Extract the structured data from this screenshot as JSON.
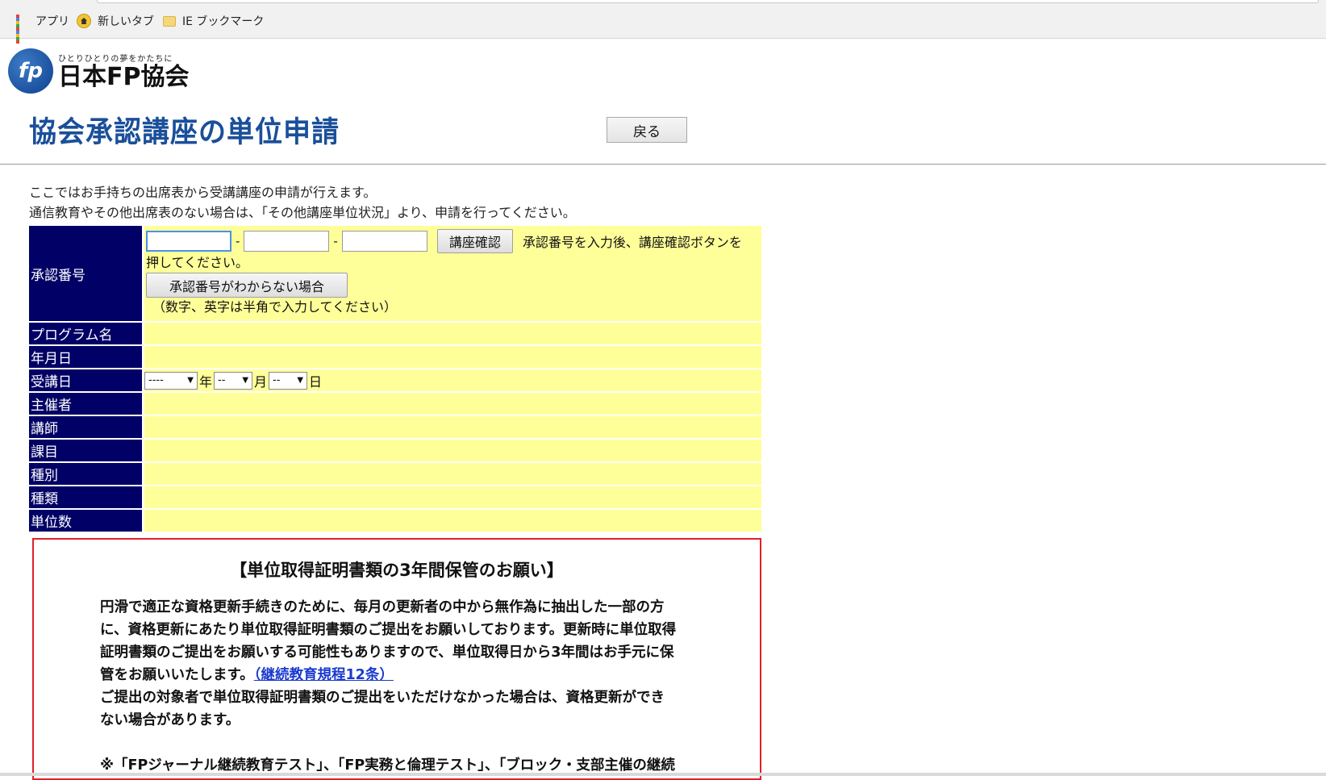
{
  "bookmarks": [
    {
      "label": "アプリ",
      "icon": "apps-grid-icon"
    },
    {
      "label": "新しいタブ",
      "icon": "home-icon"
    },
    {
      "label": "IE ブックマーク",
      "icon": "folder-icon"
    }
  ],
  "header": {
    "logo_tagline": "ひとりひとりの夢をかたちに",
    "logo_name": "日本FP協会",
    "page_title": "協会承認講座の単位申請",
    "back_label": "戻る"
  },
  "intro": [
    "ここではお手持ちの出席表から受講講座の申請が行えます。",
    "通信教育やその他出席表のない場合は、「その他講座単位状況」より、申請を行ってください。"
  ],
  "form": {
    "approval_label": "承認番号",
    "confirm_label": "講座確認",
    "hint_1": "承認番号を入力後、講座確認ボタンを",
    "hint_2": "押してください。",
    "unknown_label": "承認番号がわからない場合",
    "note": "（数字、英字は半角で入力してください）",
    "dash": "-",
    "program_label": "プログラム名",
    "date_label": "年月日",
    "attend_label": "受講日",
    "year_value": "----",
    "month_value": "--",
    "day_value": "--",
    "year_unit": "年",
    "month_unit": "月",
    "day_unit": "日",
    "host_label": "主催者",
    "lecturer_label": "講師",
    "subject_label": "課目",
    "category_label": "種別",
    "type_label": "種類",
    "credits_label": "単位数"
  },
  "notice": {
    "title": "【単位取得証明書類の3年間保管のお願い】",
    "para1_lines": [
      "円滑で適正な資格更新手続きのために、毎月の更新者の中から無作為に抽出した一部の方",
      "に、資格更新にあたり単位取得証明書類のご提出をお願いしております。更新時に単位取得",
      "証明書類のご提出をお願いする可能性もありますので、単位取得日から3年間はお手元に保"
    ],
    "para1_last": "管をお願いいたします。",
    "link": "（継続教育規程12条）",
    "para2_lines": [
      "ご提出の対象者で単位取得証明書類のご提出をいただけなかった場合は、資格更新ができ",
      "ない場合があります。"
    ],
    "para3": "※「FPジャーナル継続教育テスト」、「FP実務と倫理テスト」、「ブロック・支部主催の継続"
  },
  "colors": {
    "label_bg": "#000066",
    "value_bg": "#ffff99",
    "title_blue": "#1a4f9a",
    "notice_border": "#e0202a",
    "link": "#1a3ad0"
  }
}
